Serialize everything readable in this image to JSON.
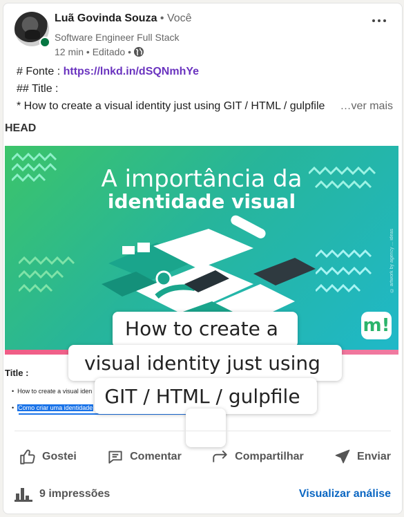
{
  "post": {
    "author_name": "Luã Govinda Souza",
    "author_relation": " • Você",
    "headline": "Software Engineer Full Stack",
    "meta_time": "12 min • Editado •",
    "text_line1_prefix": "# Fonte : ",
    "text_line1_link": "https://lnkd.in/dSQNmhYe",
    "text_line2": "## Title :",
    "text_line3": "* How to create a visual identity just using GIT / HTML / gulpfile",
    "see_more": "…ver mais"
  },
  "preview": {
    "head_label": "HEAD",
    "banner_title_line1": "A importância da",
    "banner_title_line2": "identidade visual",
    "banner_logo": "m!",
    "banner_side_text": "© artwork by agency ... ideas",
    "title_label": "Title :",
    "bullet1": "How to create a visual iden",
    "bullet2": "Como criar uma identidade"
  },
  "tooltip": {
    "line1": "How to create a",
    "line2": "visual identity just using",
    "line3": "GIT / HTML / gulpfile"
  },
  "actions": {
    "like": "Gostei",
    "comment": "Comentar",
    "share": "Compartilhar",
    "send": "Enviar"
  },
  "footer": {
    "impressions": "9 impressões",
    "analytics_link": "Visualizar análise"
  },
  "colors": {
    "link": "#6a33bf",
    "accent": "#0a66c2",
    "online": "#057642"
  }
}
